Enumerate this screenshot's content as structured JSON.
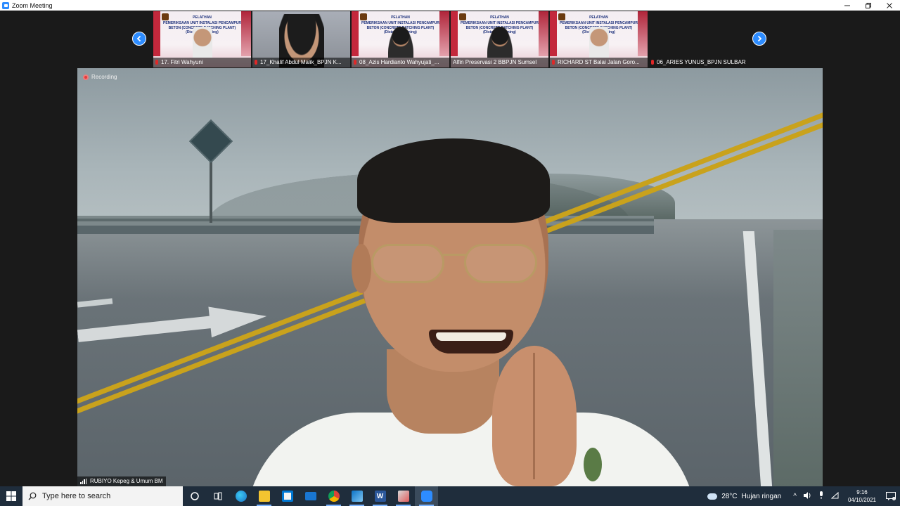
{
  "window": {
    "title": "Zoom Meeting",
    "controls": [
      "minimize",
      "restore",
      "close"
    ]
  },
  "gallery": {
    "participants": [
      {
        "name": "17. Fitri Wahyuni",
        "type": "slide",
        "slide_title": "PELATHAN",
        "slide_l2": "PEMERIKSAAN UNIT INSTALASI PENCAMPUR",
        "slide_l3": "BETON (CONCRETE BATCHING PLANT)",
        "slide_l4": "(Distance Learning)",
        "mic": "muted"
      },
      {
        "name": "17_Khalif Abdul Malik_BPJN K...",
        "type": "webcam",
        "mic": "muted"
      },
      {
        "name": "08_Azis Hardianto Wahyujati_...",
        "type": "slide",
        "slide_title": "PELATHAN",
        "slide_l2": "PEMERIKSAAN UNIT INSTALASI PENCAMPUR",
        "slide_l3": "BETON (CONCRETE BATCHING PLANT)",
        "slide_l4": "(Distance Learning)",
        "mic": "muted"
      },
      {
        "name": "Alfin Preservasi 2 BBPJN Sumsel",
        "type": "slide",
        "slide_title": "PELATHAN",
        "slide_l2": "PEMERIKSAAN UNIT INSTALASI PENCAMPUR",
        "slide_l3": "BETON (CONCRETE BATCHING PLANT)",
        "slide_l4": "(Distance Learning)",
        "mic": "none"
      },
      {
        "name": "RICHARD ST Balai Jalan Goro...",
        "type": "slide",
        "slide_title": "PELATHAN",
        "slide_l2": "PEMERIKSAAN UNIT INSTALASI PENCAMPUR",
        "slide_l3": "BETON (CONCRETE BATCHING PLANT)",
        "slide_l4": "(Distance Learning)",
        "mic": "muted"
      },
      {
        "name": "06_ARIES YUNUS_BPJN SULBAR",
        "type": "blank",
        "mic": "muted"
      }
    ],
    "prev_icon": "chevron-left-icon",
    "next_icon": "chevron-right-icon"
  },
  "main_video": {
    "recording_label": "Recording",
    "speaker_name": "RUBIYO Kepeg & Umum BM"
  },
  "taskbar": {
    "search_placeholder": "Type here to search",
    "apps": [
      "cortana",
      "task-view",
      "edge",
      "file-explorer",
      "store",
      "mail",
      "chrome",
      "photos",
      "word",
      "snipping-tool",
      "zoom"
    ],
    "weather_temp": "28°C",
    "weather_desc": "Hujan ringan",
    "time": "9:16",
    "date": "04/10/2021"
  },
  "colors": {
    "zoom_blue": "#2d8cff",
    "recording_red": "#e23c3c",
    "taskbar_bg": "#1f2d3c"
  }
}
